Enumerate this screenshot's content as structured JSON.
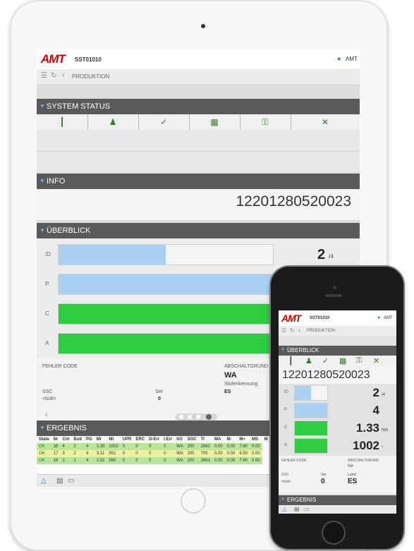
{
  "app": {
    "logo": "AMT",
    "device_id": "SST01010",
    "user": "AMT"
  },
  "nav": {
    "title": "PRODUKTION"
  },
  "system_status": {
    "title": "SYSTEM STATUS",
    "icons": [
      "wrench-icon",
      "operator-icon",
      "check-icon",
      "network-icon",
      "key-icon",
      "tool-icon"
    ]
  },
  "info": {
    "title": "INFO",
    "value": "12201280520023"
  },
  "overview": {
    "title": "ÜBERBLICK",
    "rows": [
      {
        "label": "ID",
        "fill": 0.5,
        "color": "#a8d0f0",
        "value": "2",
        "unit": "/4"
      },
      {
        "label": "P",
        "fill": 1.0,
        "color": "#a8d0f0",
        "value": "4",
        "unit": ""
      },
      {
        "label": "C",
        "fill": 1.0,
        "color": "#2ecc40",
        "value": "1.33",
        "unit": "Nm"
      },
      {
        "label": "A",
        "fill": 1.0,
        "color": "#2ecc40",
        "value": "1002",
        "unit": "°"
      }
    ],
    "fehler_code_label": "FEHLER CODE",
    "abschaltgrund_label": "ABSCHALTGRUND",
    "abschaltgrund_value": "WA",
    "stufenkennung_label": "Stufenkennung",
    "ssc_label": "SSC",
    "ssc_value": "<bolt>",
    "ser_label": "Ser",
    "ser_value": "0",
    "stufe_value": "ES",
    "label_label": "Label"
  },
  "results": {
    "title": "ERGEBNIS",
    "columns": [
      "State",
      "Nr",
      "Cnt",
      "Bolt",
      "PG",
      "MI",
      "MI",
      "UPR",
      "ERC",
      "D-Err",
      "I.Err",
      "SO",
      "SOC",
      "TI",
      "MA",
      "M-",
      "M+",
      "MS",
      "M"
    ],
    "rows": [
      [
        "OK",
        "16",
        "4",
        "2",
        "4",
        "1.33",
        "1002",
        "0",
        "0",
        "0",
        "0",
        "WA",
        "200",
        "2662",
        "0.00",
        "0.00",
        "7.60",
        "0.00"
      ],
      [
        "OK",
        "17",
        "3",
        "2",
        "4",
        "3.11",
        "951",
        "0",
        "0",
        "0",
        "0",
        "WA",
        "200",
        "705",
        "0.00",
        "0.00",
        "6.50",
        "0.00"
      ],
      [
        "OK",
        "18",
        "2",
        "1",
        "4",
        "2.52",
        "980",
        "0",
        "0",
        "0",
        "0",
        "WA",
        "200",
        "2661",
        "0.00",
        "0.00",
        "7.60",
        "0.00"
      ]
    ]
  },
  "phone": {
    "logo": "AMT",
    "device_id": "SST01010",
    "user": "AMT",
    "nav_title": "PRODUKTION",
    "overview_title": "ÜBERBLICK",
    "info_value": "12201280520023",
    "results_title": "ERGEBNIS"
  }
}
